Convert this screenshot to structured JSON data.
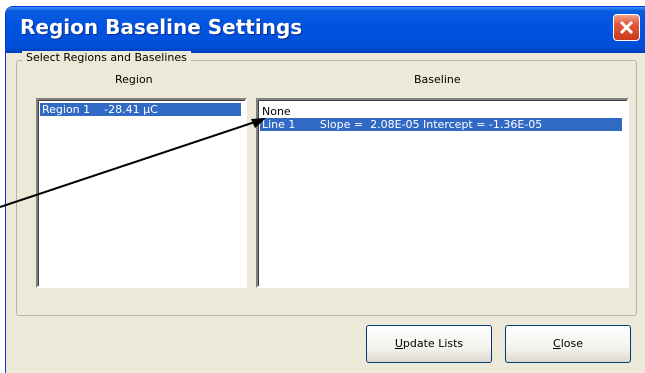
{
  "window": {
    "title": "Region Baseline Settings"
  },
  "group": {
    "label": "Select Regions and Baselines"
  },
  "region": {
    "header": "Region",
    "items": [
      {
        "label": "Region 1    -28.41 µC",
        "selected": true
      }
    ]
  },
  "baseline": {
    "header": "Baseline",
    "items": [
      {
        "label": "None",
        "selected": false
      },
      {
        "label": "Line 1       Slope =  2.08E-05 Intercept = -1.36E-05",
        "selected": true
      }
    ]
  },
  "buttons": {
    "update_mnemonic": "U",
    "update_rest": "pdate Lists",
    "close_mnemonic": "C",
    "close_rest": "lose"
  },
  "icons": {
    "close": "close-icon",
    "annotation": "arrow-annotation"
  },
  "colors": {
    "title_bar": "#0054e3",
    "selection": "#316ac5",
    "close_button": "#e0583b",
    "dialog_bg": "#ece9d8"
  }
}
